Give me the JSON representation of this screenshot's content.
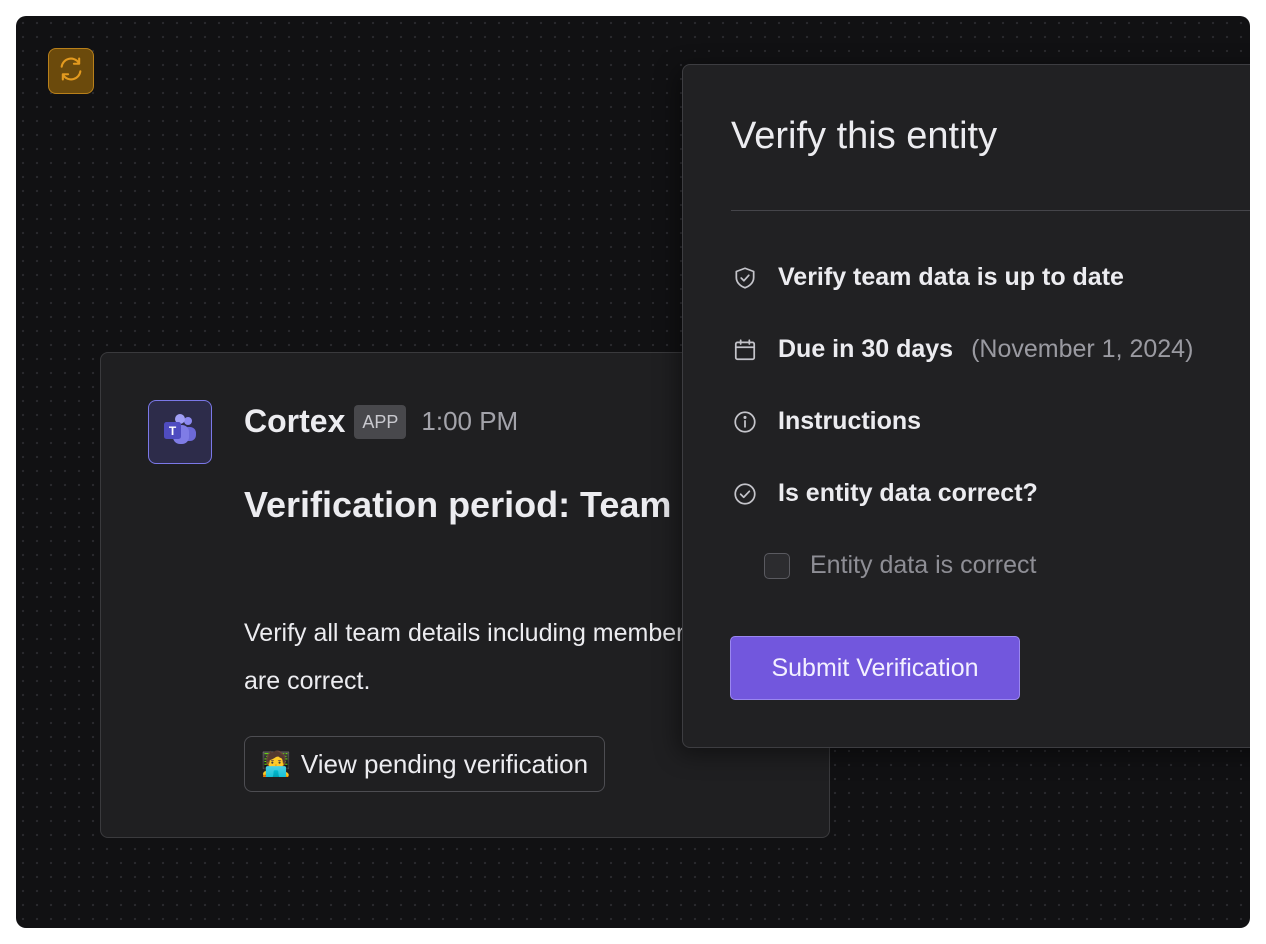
{
  "colors": {
    "accent": "#7257dd",
    "badge_orange": "#e39a1f",
    "teams_purple": "#7b78e8"
  },
  "sync_badge": {
    "icon": "refresh-icon"
  },
  "message": {
    "app_icon": "teams-icon",
    "sender": "Cortex",
    "tag": "APP",
    "time": "1:00 PM",
    "title": "Verification period: Team Details",
    "body": "Verify all team details including members and links are correct.",
    "button": {
      "emoji": "🧑‍💻",
      "label": "View pending verification"
    }
  },
  "panel": {
    "title": "Verify this entity",
    "items": [
      {
        "icon": "shield-check-icon",
        "label": "Verify team data is up to date"
      },
      {
        "icon": "calendar-icon",
        "label": "Due in 30 days",
        "sub": "(November 1, 2024)"
      },
      {
        "icon": "info-icon",
        "label": "Instructions"
      },
      {
        "icon": "check-circle-icon",
        "label": "Is entity data correct?"
      }
    ],
    "checkbox": {
      "label": "Entity data is correct",
      "checked": false
    },
    "submit_label": "Submit Verification"
  }
}
